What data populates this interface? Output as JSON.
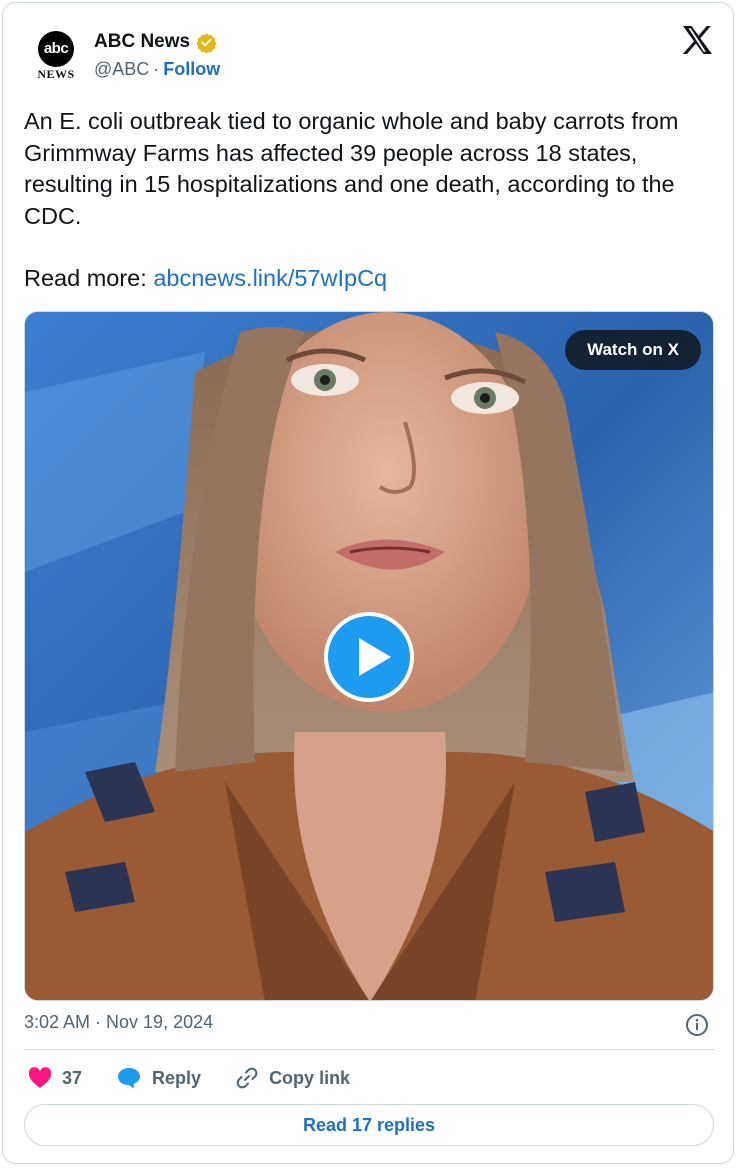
{
  "author": {
    "display_name": "ABC News",
    "handle": "@ABC",
    "separator": "·",
    "follow_label": "Follow",
    "avatar_top": "abc",
    "avatar_bottom": "NEWS",
    "verified": true,
    "verified_color": "#e2b719"
  },
  "tweet": {
    "text": "An E. coli outbreak tied to organic whole and baby carrots from Grimmway Farms has affected 39 people across 18 states, resulting in 15 hospitalizations and one death, according to the CDC.",
    "read_more_prefix": "Read more: ",
    "link_text": "abcnews.link/57wIpCq",
    "link_color": "#1d70c2"
  },
  "media": {
    "type": "video",
    "watch_label": "Watch on X",
    "play_icon": "play-icon",
    "play_color": "#1d9bf0"
  },
  "meta": {
    "timestamp": "3:02 AM · Nov 19, 2024",
    "info_icon": "info-icon"
  },
  "actions": {
    "like_count": "37",
    "like_color": "#f91880",
    "reply_label": "Reply",
    "copy_label": "Copy link",
    "read_replies_label": "Read 17 replies"
  },
  "brand": {
    "x_logo": "x-logo-icon"
  }
}
